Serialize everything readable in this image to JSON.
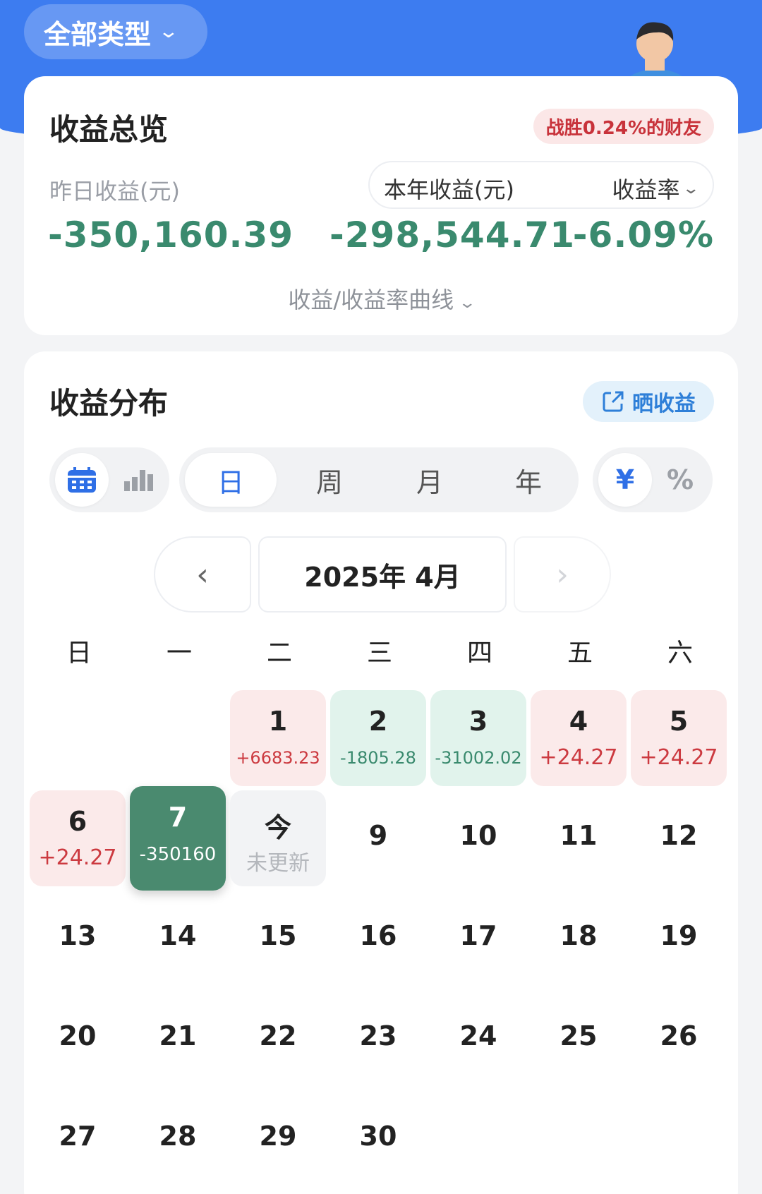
{
  "header": {
    "type_filter": "全部类型"
  },
  "overview": {
    "title": "收益总览",
    "beat_badge": "战胜0.24%的财友",
    "yesterday_label": "昨日收益(元)",
    "yesterday_value": "-350,160.39",
    "year_label": "本年收益(元)",
    "year_value": "-298,544.71",
    "rate_label": "收益率",
    "rate_value": "-6.09%",
    "curve_toggle": "收益/收益率曲线"
  },
  "distribution": {
    "title": "收益分布",
    "share_label": "晒收益",
    "period_tabs": [
      "日",
      "周",
      "月",
      "年"
    ],
    "active_period": "日",
    "unit_tabs": [
      "¥",
      "%"
    ],
    "active_unit": "¥",
    "month_label": "2025年 4月",
    "weekdays": [
      "日",
      "一",
      "二",
      "三",
      "四",
      "五",
      "六"
    ],
    "days": [
      {
        "day": "1",
        "value": "+6683.23",
        "kind": "up"
      },
      {
        "day": "2",
        "value": "-1805.28",
        "kind": "down"
      },
      {
        "day": "3",
        "value": "-31002.02",
        "kind": "down"
      },
      {
        "day": "4",
        "value": "+24.27",
        "kind": "up big"
      },
      {
        "day": "5",
        "value": "+24.27",
        "kind": "up big"
      },
      {
        "day": "6",
        "value": "+24.27",
        "kind": "up big"
      },
      {
        "day": "7",
        "value": "-350160",
        "kind": "sel"
      },
      {
        "day": "今",
        "value": "未更新",
        "kind": "today"
      },
      {
        "day": "9"
      },
      {
        "day": "10"
      },
      {
        "day": "11"
      },
      {
        "day": "12"
      },
      {
        "day": "13"
      },
      {
        "day": "14"
      },
      {
        "day": "15"
      },
      {
        "day": "16"
      },
      {
        "day": "17"
      },
      {
        "day": "18"
      },
      {
        "day": "19"
      },
      {
        "day": "20"
      },
      {
        "day": "21"
      },
      {
        "day": "22"
      },
      {
        "day": "23"
      },
      {
        "day": "24"
      },
      {
        "day": "25"
      },
      {
        "day": "26"
      },
      {
        "day": "27"
      },
      {
        "day": "28"
      },
      {
        "day": "29"
      },
      {
        "day": "30"
      }
    ]
  },
  "colors": {
    "brand_blue": "#3d7cf0",
    "loss_green": "#3a8a6e",
    "gain_red": "#cc3a40"
  }
}
